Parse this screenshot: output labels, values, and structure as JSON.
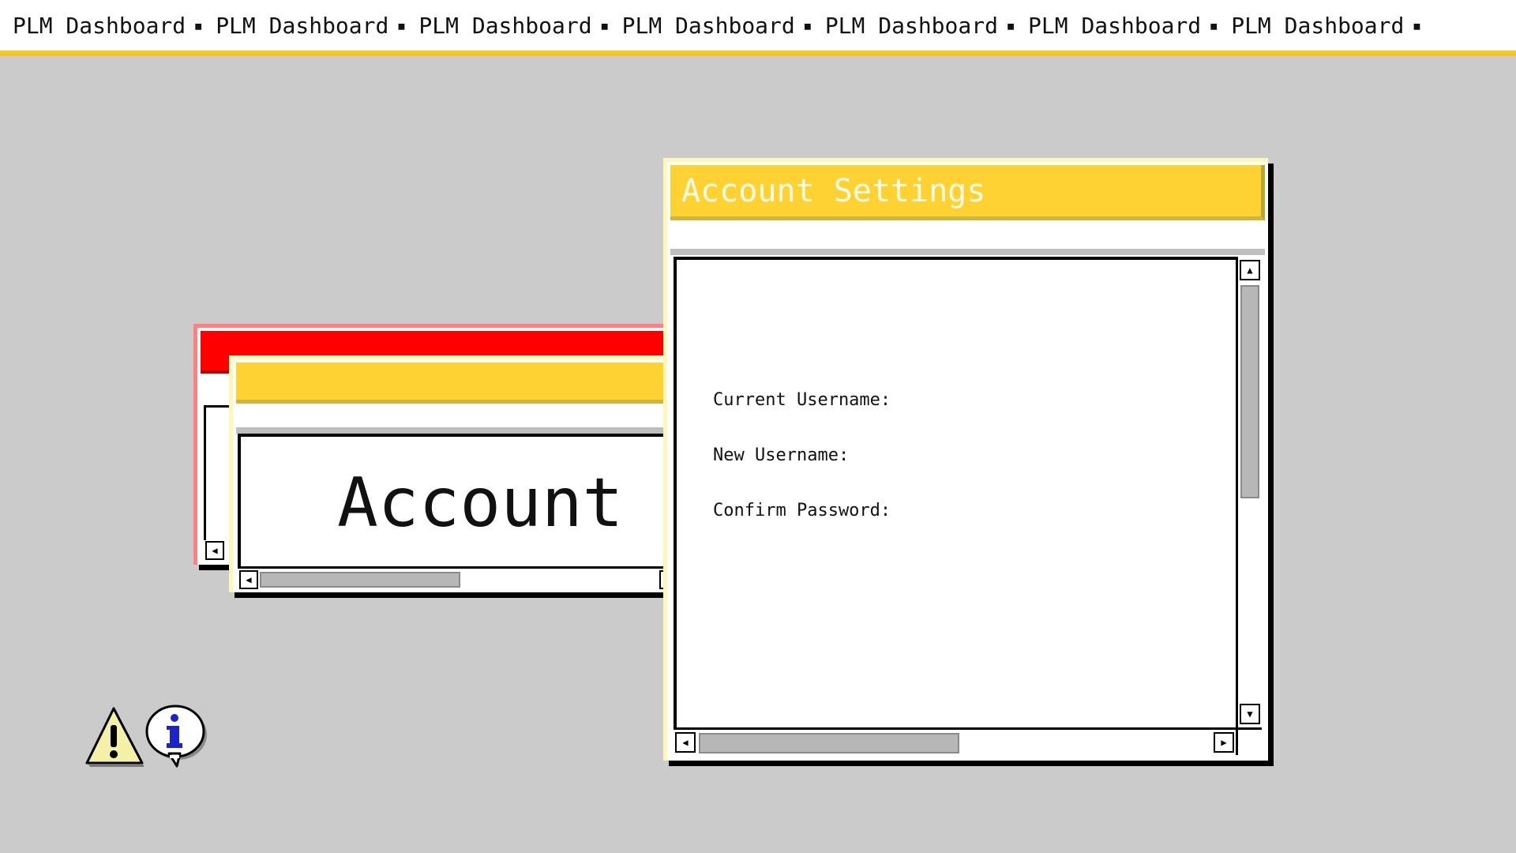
{
  "marquee": {
    "items": [
      "PLM Dashboard",
      "PLM Dashboard",
      "PLM Dashboard",
      "PLM Dashboard",
      "PLM Dashboard",
      "PLM Dashboard",
      "PLM Dashboard"
    ],
    "separator": "▪"
  },
  "colors": {
    "background": "#cbcbcb",
    "accent_yellow": "#fdd232",
    "alert_red": "#ff0000",
    "marquee_border": "#f2c727"
  },
  "account_settings_window": {
    "title": "Account Settings",
    "fields": [
      {
        "label": "Current Username:"
      },
      {
        "label": "New Username:"
      },
      {
        "label": "Confirm Password:"
      }
    ]
  },
  "account_window": {
    "title": "",
    "content": "Account"
  },
  "red_window": {
    "title": ""
  },
  "icons": [
    {
      "name": "warning-icon"
    },
    {
      "name": "info-icon"
    }
  ]
}
